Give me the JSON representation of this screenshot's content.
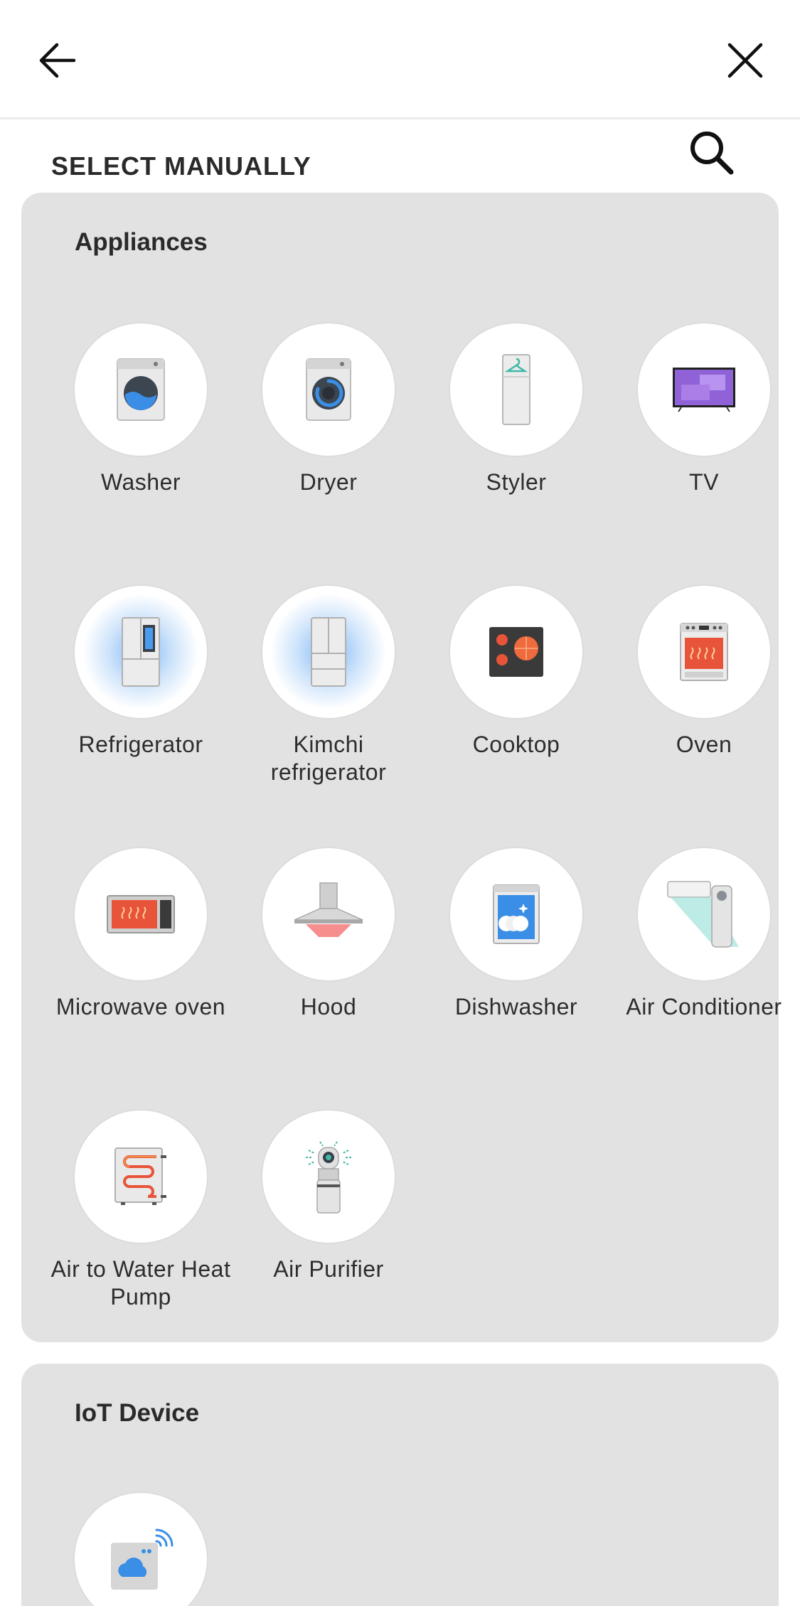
{
  "header": {
    "back_icon": "arrow-left-icon",
    "close_icon": "close-icon"
  },
  "select_manually": {
    "title": "SELECT MANUALLY",
    "search_icon": "search-icon"
  },
  "appliances": {
    "title": "Appliances",
    "items": [
      {
        "label": "Washer",
        "icon": "washer-icon"
      },
      {
        "label": "Dryer",
        "icon": "dryer-icon"
      },
      {
        "label": "Styler",
        "icon": "styler-icon"
      },
      {
        "label": "TV",
        "icon": "tv-icon"
      },
      {
        "label": "Refrigerator",
        "icon": "refrigerator-icon"
      },
      {
        "label": "Kimchi refrigerator",
        "icon": "kimchi-refrigerator-icon"
      },
      {
        "label": "Cooktop",
        "icon": "cooktop-icon"
      },
      {
        "label": "Oven",
        "icon": "oven-icon"
      },
      {
        "label": "Microwave oven",
        "icon": "microwave-icon"
      },
      {
        "label": "Hood",
        "icon": "hood-icon"
      },
      {
        "label": "Dishwasher",
        "icon": "dishwasher-icon"
      },
      {
        "label": "Air Conditioner",
        "icon": "air-conditioner-icon"
      },
      {
        "label": "Air to Water Heat Pump",
        "icon": "heat-pump-icon"
      },
      {
        "label": "Air Purifier",
        "icon": "air-purifier-icon"
      }
    ]
  },
  "iot": {
    "title": "IoT Device",
    "items": [
      {
        "label": "",
        "icon": "iot-cloud-icon"
      }
    ]
  },
  "colors": {
    "card_bg": "#e2e2e2",
    "accent_blue": "#3a8ee6",
    "heat_red": "#e8543a"
  }
}
